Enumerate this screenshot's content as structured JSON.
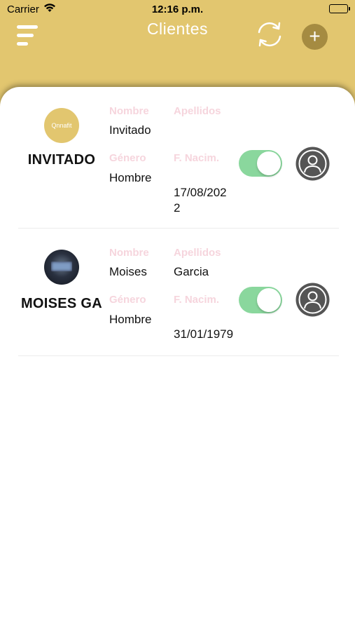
{
  "status_bar": {
    "carrier": "Carrier",
    "time": "12:16 p.m."
  },
  "header": {
    "title": "Clientes",
    "menu_icon": "hamburger-icon",
    "sync_icon": "sync-icon",
    "add_label": "+"
  },
  "colors": {
    "header_bg": "#e2c66f",
    "label_pink": "#f6d5dd",
    "toggle_on": "#8ad79d",
    "add_button": "#a58b41"
  },
  "labels": {
    "nombre": "Nombre",
    "apellidos": "Apellidos",
    "genero": "Género",
    "f_nacim": "F. Nacim."
  },
  "clients": [
    {
      "display_name": "INVITADO",
      "avatar_text": "Qnnafit",
      "nombre": "Invitado",
      "apellidos": "",
      "genero": "Hombre",
      "f_nacim": "17/08/2022",
      "f_nacim_line1": "17/08/202",
      "f_nacim_line2": "2",
      "active": true
    },
    {
      "display_name": "MOISES GA",
      "nombre": "Moises",
      "apellidos": "Garcia",
      "genero": "Hombre",
      "f_nacim": "31/01/1979",
      "active": true
    }
  ]
}
